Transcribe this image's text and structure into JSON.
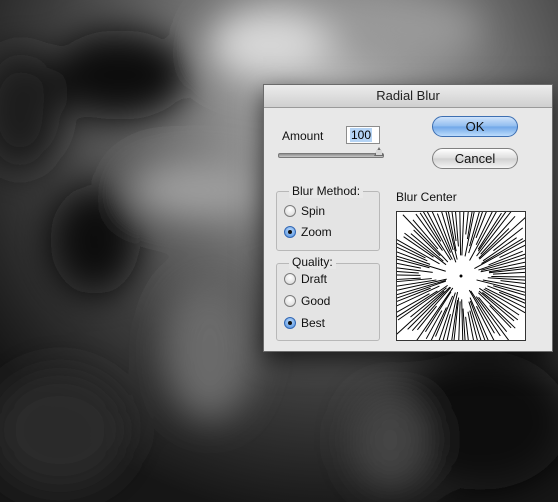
{
  "dialog": {
    "title": "Radial Blur",
    "amount_label": "Amount",
    "amount_value": "100",
    "amount_slider_level": 1.0,
    "ok_label": "OK",
    "cancel_label": "Cancel",
    "blur_method": {
      "title": "Blur Method:",
      "options": [
        "Spin",
        "Zoom"
      ],
      "selected": "Zoom"
    },
    "quality": {
      "title": "Quality:",
      "options": [
        "Draft",
        "Good",
        "Best"
      ],
      "selected": "Best"
    },
    "blur_center_label": "Blur Center"
  },
  "colors": {
    "accent": "#6fa6e8",
    "background_image": "#1a1a1a"
  },
  "icons": [
    "radio-icon",
    "slider-thumb-icon",
    "blur-center-preview"
  ]
}
